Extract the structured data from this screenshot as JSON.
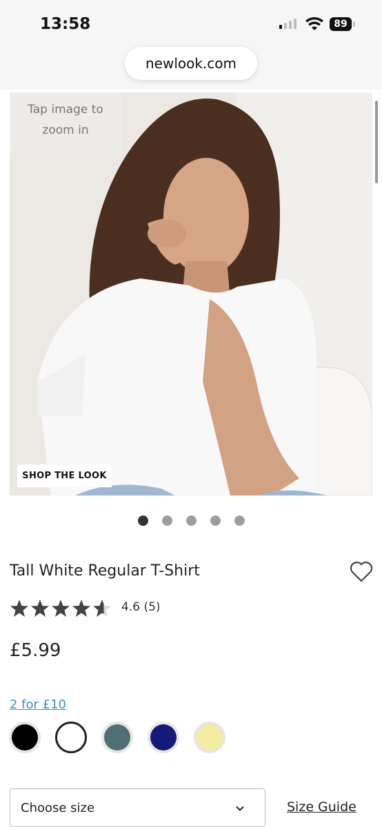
{
  "status_bar": {
    "time": "13:58",
    "battery": "89"
  },
  "browser": {
    "url": "newlook.com"
  },
  "gallery": {
    "zoom_hint_line1": "Tap image to",
    "zoom_hint_line2": "zoom in",
    "shop_the_look": "SHOP THE LOOK",
    "image_count": 5,
    "active_index": 0
  },
  "product": {
    "title": "Tall White Regular T-Shirt",
    "rating": 4.6,
    "rating_text": "4.6 (5)",
    "price": "£5.99",
    "promo": "2 for £10",
    "colors": [
      {
        "name": "black",
        "hex": "#000000"
      },
      {
        "name": "white",
        "hex": "#ffffff",
        "selected": true
      },
      {
        "name": "slate",
        "hex": "#4e6f74"
      },
      {
        "name": "navy",
        "hex": "#151a78"
      },
      {
        "name": "yellow",
        "hex": "#f2eda0"
      }
    ]
  },
  "size": {
    "select_label": "Choose size",
    "guide_label": "Size Guide"
  }
}
